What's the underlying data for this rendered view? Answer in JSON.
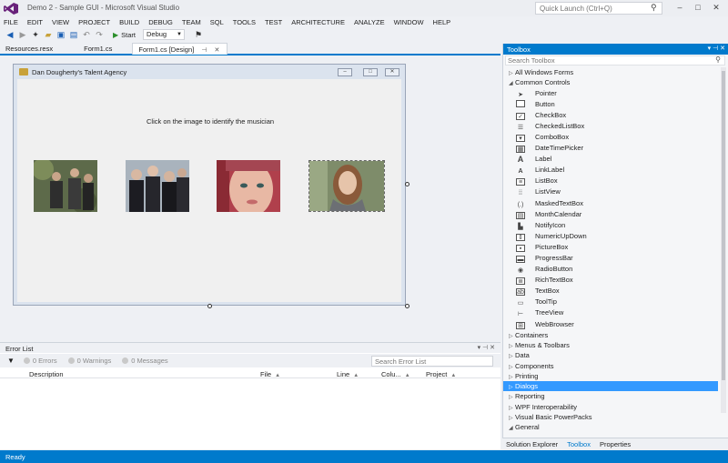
{
  "window": {
    "title": "Demo 2 - Sample GUI - Microsoft Visual Studio",
    "quick_launch_placeholder": "Quick Launch (Ctrl+Q)"
  },
  "menu": [
    "FILE",
    "EDIT",
    "VIEW",
    "PROJECT",
    "BUILD",
    "DEBUG",
    "TEAM",
    "SQL",
    "TOOLS",
    "TEST",
    "ARCHITECTURE",
    "ANALYZE",
    "WINDOW",
    "HELP"
  ],
  "toolbar": {
    "start_label": "Start",
    "config_value": "Debug"
  },
  "doc_tabs": [
    {
      "label": "Resources.resx"
    },
    {
      "label": "Form1.cs"
    },
    {
      "label": "Form1.cs [Design]"
    }
  ],
  "form": {
    "title": "Dan Dougherty's Talent Agency",
    "instruction": "Click on the image to identify the musician",
    "pictures": [
      "musician-photo-1",
      "musician-photo-2",
      "musician-photo-3",
      "musician-photo-4"
    ]
  },
  "error_list": {
    "title": "Error List",
    "errors": "0 Errors",
    "warnings": "0 Warnings",
    "messages": "0 Messages",
    "search_placeholder": "Search Error List",
    "columns": [
      "Description",
      "File",
      "Line",
      "Colu...",
      "Project"
    ]
  },
  "status": {
    "text": "Ready",
    "color": "#007acc"
  },
  "toolbox": {
    "title": "Toolbox",
    "search_placeholder": "Search Toolbox",
    "all_windows_forms": "All Windows Forms",
    "common_controls": "Common Controls",
    "items": [
      "Pointer",
      "Button",
      "CheckBox",
      "CheckedListBox",
      "ComboBox",
      "DateTimePicker",
      "Label",
      "LinkLabel",
      "ListBox",
      "ListView",
      "MaskedTextBox",
      "MonthCalendar",
      "NotifyIcon",
      "NumericUpDown",
      "PictureBox",
      "ProgressBar",
      "RadioButton",
      "RichTextBox",
      "TextBox",
      "ToolTip",
      "TreeView",
      "WebBrowser"
    ],
    "groups": [
      "Containers",
      "Menus & Toolbars",
      "Data",
      "Components",
      "Printing",
      "Dialogs",
      "Reporting",
      "WPF Interoperability",
      "Visual Basic PowerPacks",
      "General"
    ],
    "selected_group": "Dialogs"
  },
  "bottom_tabs": [
    "Solution Explorer",
    "Toolbox",
    "Properties"
  ]
}
